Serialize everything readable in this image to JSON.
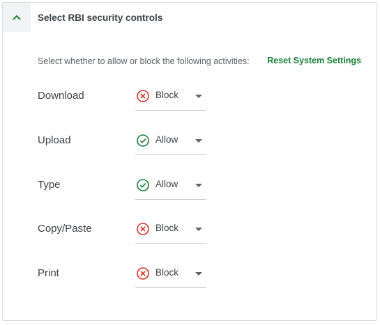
{
  "section": {
    "title": "Select RBI security controls",
    "instructions": "Select whether to allow or block the following activities:",
    "reset_label": "Reset System Settings"
  },
  "colors": {
    "block": "#d93025",
    "allow": "#188038",
    "accent": "#188038"
  },
  "controls": [
    {
      "label": "Download",
      "value": "Block",
      "status": "block",
      "icon": "block-icon"
    },
    {
      "label": "Upload",
      "value": "Allow",
      "status": "allow",
      "icon": "allow-icon"
    },
    {
      "label": "Type",
      "value": "Allow",
      "status": "allow",
      "icon": "allow-icon"
    },
    {
      "label": "Copy/Paste",
      "value": "Block",
      "status": "block",
      "icon": "block-icon"
    },
    {
      "label": "Print",
      "value": "Block",
      "status": "block",
      "icon": "block-icon"
    }
  ]
}
